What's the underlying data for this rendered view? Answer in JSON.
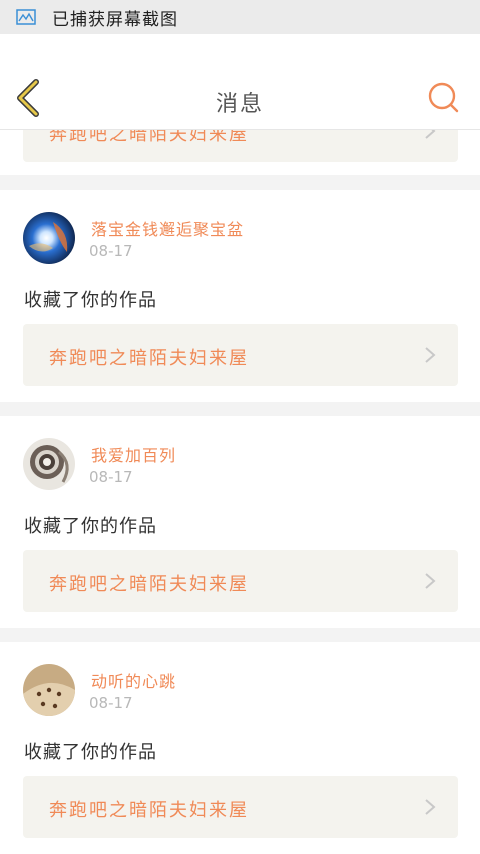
{
  "status_bar": {
    "text": "已捕获屏幕截图"
  },
  "header": {
    "title": "消息"
  },
  "partial_item": {
    "work_title": "奔跑吧之暗陌夫妇来屋"
  },
  "messages": [
    {
      "username": "落宝金钱邂逅聚宝盆",
      "date": "08-17",
      "action": "收藏了你的作品",
      "work_title": "奔跑吧之暗陌夫妇来屋"
    },
    {
      "username": "我爱加百列",
      "date": "08-17",
      "action": "收藏了你的作品",
      "work_title": "奔跑吧之暗陌夫妇来屋"
    },
    {
      "username": "动听的心跳",
      "date": "08-17",
      "action": "收藏了你的作品",
      "work_title": "奔跑吧之暗陌夫妇来屋"
    }
  ],
  "colors": {
    "accent": "#f08a57",
    "back_arrow": "#e6c84a",
    "card_link_bg": "#f4f3ee"
  }
}
